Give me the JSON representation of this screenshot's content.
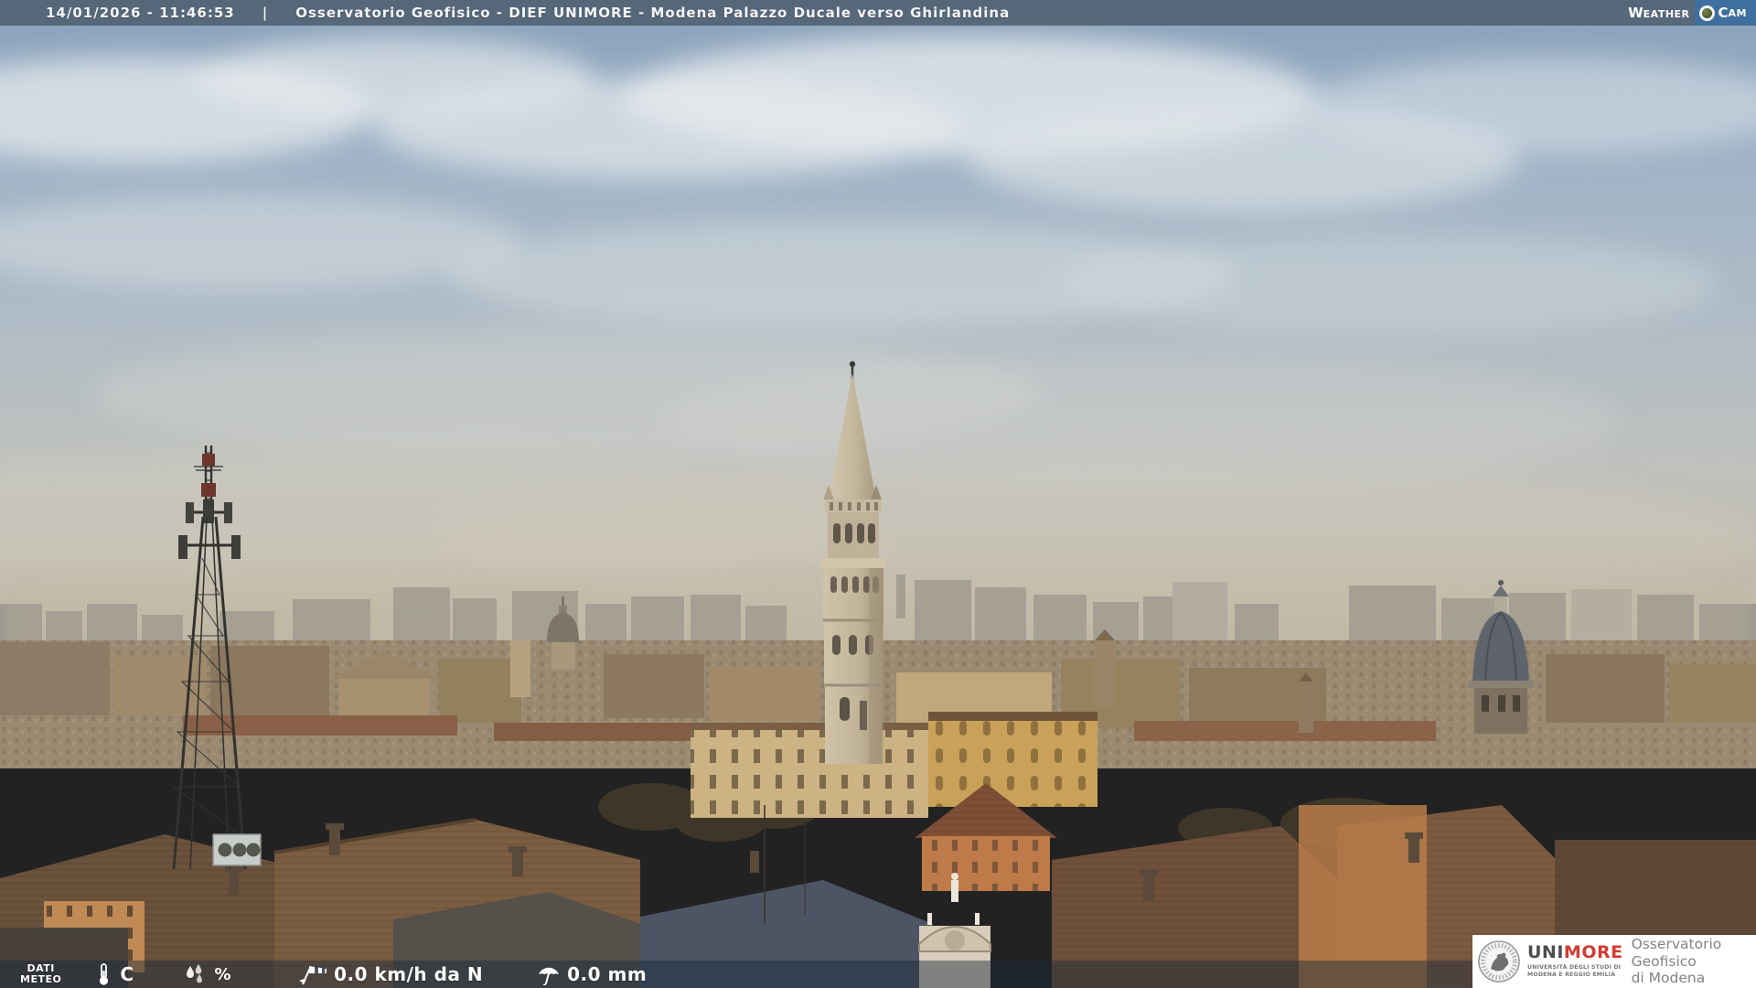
{
  "header": {
    "timestamp": "14/01/2026 - 11:46:53",
    "separator": "|",
    "title": "Osservatorio Geofisico - DIEF UNIMORE - Modena Palazzo Ducale verso Ghirlandina",
    "logo": {
      "w": "W",
      "eather": "EATHER",
      "c": "C",
      "am": "AM"
    }
  },
  "weather_bar": {
    "label_line1": "DATI",
    "label_line2": "METEO",
    "temperature_unit": "C",
    "humidity_unit": "%",
    "wind_value": "0.0 km/h da N",
    "rain_value": "0.0 mm",
    "icons": {
      "temperature": "thermometer-icon",
      "humidity": "drops-icon",
      "wind": "windsock-icon",
      "rain": "umbrella-icon"
    }
  },
  "branding": {
    "uni": "UNI",
    "more": "MORE",
    "tagline1": "UNIVERSITÀ DEGLI STUDI DI",
    "tagline2": "MODENA E REGGIO EMILIA",
    "observatory_line1": "Osservatorio Geofisico",
    "observatory_line2": "di Modena"
  },
  "colors": {
    "topbar_overlay": "rgba(72,87,102,0.78)",
    "meteobar_overlay": "rgba(24,40,58,0.45)",
    "cam_blue": "#3f6f9e",
    "more_red": "#d23b33",
    "sky_top": "#87a0ba",
    "haze": "#c2bcae"
  }
}
